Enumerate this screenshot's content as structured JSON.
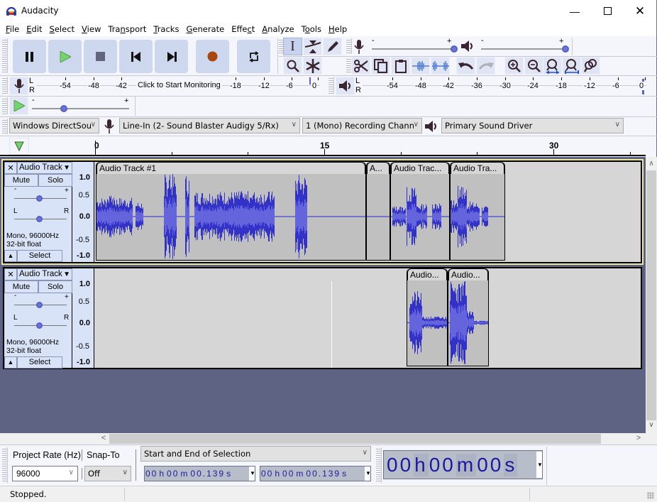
{
  "app": {
    "title": "Audacity",
    "window_controls": [
      "minimize",
      "maximize",
      "close"
    ]
  },
  "menu": [
    {
      "label": "File",
      "accel": "F"
    },
    {
      "label": "Edit",
      "accel": "E"
    },
    {
      "label": "Select",
      "accel": "S"
    },
    {
      "label": "View",
      "accel": "V"
    },
    {
      "label": "Transport",
      "accel": "n"
    },
    {
      "label": "Tracks",
      "accel": "T"
    },
    {
      "label": "Generate",
      "accel": "G"
    },
    {
      "label": "Effect",
      "accel": "c"
    },
    {
      "label": "Analyze",
      "accel": "A"
    },
    {
      "label": "Tools",
      "accel": "o"
    },
    {
      "label": "Help",
      "accel": "H"
    }
  ],
  "transport": {
    "buttons": [
      "pause",
      "play",
      "stop",
      "skip-to-start",
      "skip-to-end",
      "record",
      "loop"
    ],
    "colors": {
      "play": "#72d46a",
      "record": "#a8480f",
      "stop": "#63647f"
    }
  },
  "tools": {
    "row1": [
      "selection-tool",
      "envelope-tool",
      "draw-tool"
    ],
    "row2": [
      "zoom-tool",
      "multi-tool"
    ],
    "active": "selection-tool"
  },
  "mixer": {
    "record_volume": {
      "min_label": "-",
      "max_label": "+",
      "value": 1.0
    },
    "playback_volume": {
      "min_label": "-",
      "max_label": "+",
      "value": 1.0
    }
  },
  "edit_toolbar": [
    "cut",
    "copy",
    "paste",
    "trim-audio",
    "silence-audio",
    "undo",
    "redo",
    "zoom-in",
    "zoom-out",
    "fit-selection",
    "fit-project",
    "zoom-toggle"
  ],
  "record_meter": {
    "channels": [
      "L",
      "R"
    ],
    "ticks": [
      "-54",
      "-48",
      "-42",
      "-18",
      "-12",
      "-6",
      "0"
    ],
    "prompt": "Click to Start Monitoring"
  },
  "playback_meter": {
    "channels": [
      "L",
      "R"
    ],
    "ticks": [
      "-54",
      "-48",
      "-42",
      "-36",
      "-30",
      "-24",
      "-18",
      "-12",
      "-6",
      "0"
    ]
  },
  "play_at_speed": {
    "min_label": "-",
    "max_label": "+",
    "value": 0.35
  },
  "device": {
    "host": "Windows DirectSou",
    "recording_device": "Line-In (2- Sound Blaster Audigy 5/Rx)",
    "channels": "1 (Mono) Recording Chann",
    "playback_device": "Primary Sound Driver"
  },
  "timeline": {
    "labels": [
      "0",
      "15",
      "30"
    ]
  },
  "tracks": [
    {
      "name": "Audio Track",
      "mute": "Mute",
      "solo": "Solo",
      "gain": {
        "min": "-",
        "max": "+",
        "value": 0.5
      },
      "pan": {
        "min": "L",
        "max": "R",
        "value": 0.5
      },
      "info_line1": "Mono, 96000Hz",
      "info_line2": "32-bit float",
      "select": "Select",
      "scale": [
        "1.0",
        "0.5",
        "0.0",
        "-0.5",
        "-1.0"
      ],
      "selected": true,
      "clips": [
        "Audio Track #1",
        "A...",
        "Audio Trac...",
        "Audio Tra..."
      ]
    },
    {
      "name": "Audio Track",
      "mute": "Mute",
      "solo": "Solo",
      "gain": {
        "min": "-",
        "max": "+",
        "value": 0.5
      },
      "pan": {
        "min": "L",
        "max": "R",
        "value": 0.5
      },
      "info_line1": "Mono, 96000Hz",
      "info_line2": "32-bit float",
      "select": "Select",
      "scale": [
        "1.0",
        "0.5",
        "0.0",
        "-0.5",
        "-1.0"
      ],
      "selected": false,
      "clips": [
        "Audio...",
        "Audio..."
      ]
    }
  ],
  "selection_bar": {
    "project_rate_label": "Project Rate (Hz)",
    "project_rate": "96000",
    "snap_to_label": "Snap-To",
    "snap_to": "Off",
    "selection_mode": "Start and End of Selection",
    "start": {
      "h": "00",
      "m": "00",
      "s": "00.139"
    },
    "end": {
      "h": "00",
      "m": "00",
      "s": "00.139"
    }
  },
  "time_display": {
    "h": "00",
    "m": "00",
    "s": "00"
  },
  "status": "Stopped."
}
